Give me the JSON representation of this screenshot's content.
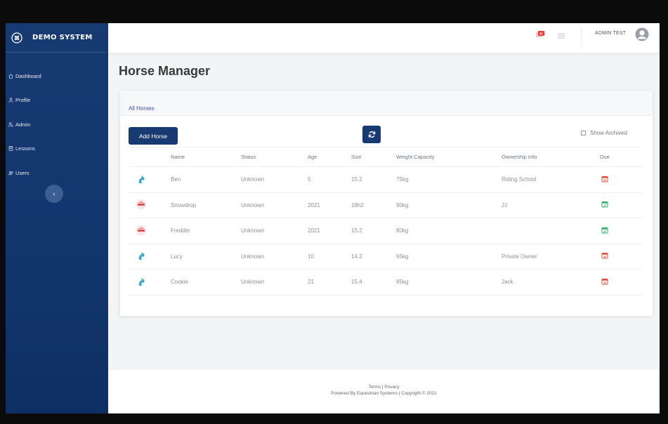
{
  "sidebar": {
    "brand": "DEMO SYSTEM",
    "items": [
      {
        "label": "Dashboard",
        "icon": "home-icon"
      },
      {
        "label": "Profile",
        "icon": "user-icon"
      },
      {
        "label": "Admin",
        "icon": "users-cog-icon"
      },
      {
        "label": "Lessons",
        "icon": "book-icon"
      },
      {
        "label": "Users",
        "icon": "users-icon"
      }
    ],
    "collapse_label": "‹"
  },
  "topbar": {
    "username": "ADMIN TEST"
  },
  "page": {
    "title": "Horse Manager"
  },
  "card": {
    "title": "All Horses",
    "add_button": "Add Horse",
    "show_archived": "Show Archived"
  },
  "table": {
    "headers": [
      "Name",
      "Status",
      "Age",
      "Size",
      "Weight Capacity",
      "Ownership Info",
      "Due"
    ],
    "rows": [
      {
        "name": "Ben",
        "status": "Unknown",
        "age": "5",
        "size": "15.2",
        "weight": "75kg",
        "ownership": "Riding School",
        "avatar": "horse-head-blue",
        "due": "red"
      },
      {
        "name": "Snowdrop",
        "status": "Unknown",
        "age": "2021",
        "size": "18h2",
        "weight": "90kg",
        "ownership": "JJ",
        "avatar": "horse-badge-pink",
        "due": "green"
      },
      {
        "name": "Freddie",
        "status": "Unknown",
        "age": "2021",
        "size": "15.2",
        "weight": "80kg",
        "ownership": "",
        "avatar": "horse-badge-pink",
        "due": "green"
      },
      {
        "name": "Lucy",
        "status": "Unknown",
        "age": "10",
        "size": "14.2",
        "weight": "65kg",
        "ownership": "Private Owner",
        "avatar": "horse-head-blue",
        "due": "red"
      },
      {
        "name": "Cookie",
        "status": "Unknown",
        "age": "21",
        "size": "15.4",
        "weight": "85kg",
        "ownership": "Jack",
        "avatar": "horse-head-blue",
        "due": "red"
      }
    ]
  },
  "footer": {
    "links": "Terms | Privacy",
    "copyright": "Powered By Equestrian Systems | Copyright © 2021"
  },
  "colors": {
    "sidebar": "#173a73",
    "accent": "#173a73",
    "due_red": "#e74c3c",
    "due_green": "#2fb36b",
    "horse_blue": "#3aa6c9"
  }
}
